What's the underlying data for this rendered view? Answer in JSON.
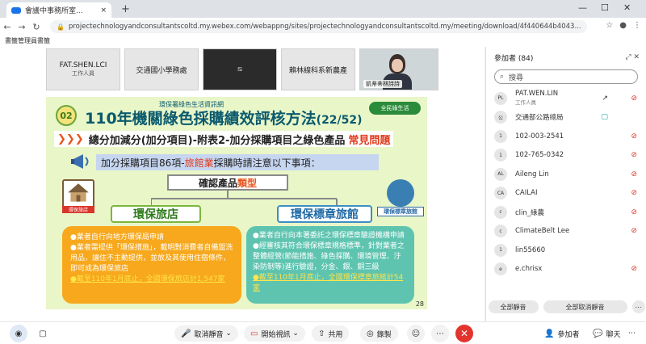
{
  "browser": {
    "tab_title": "會議中事務所室...",
    "tab_close": "×",
    "new_tab": "+",
    "window_controls": [
      "—",
      "☐",
      "✕"
    ],
    "url": "projectechnologyandconsultantscoltd.my.webex.com/webappng/sites/projectechnologyandconsultantscoltd.my/meeting/download/4f440644b4043...",
    "bookmarks_label": "書籤管理員書籤"
  },
  "stage": {
    "thumbnails": [
      {
        "name": "FAT.SHEN.LCI",
        "sub": "工作人員"
      },
      {
        "name": "交通國小學務處",
        "sub": ""
      },
      {
        "name": "⧅",
        "sub": ""
      },
      {
        "name": "賴林線科系新農產",
        "sub": ""
      },
      {
        "name": "",
        "nametag": "凱蒂蒂林詩詩"
      }
    ]
  },
  "slide": {
    "header_small": "環保署綠色生活資訊網",
    "number": "02",
    "title": "110年機關綠色採購績效評核方法",
    "title_page": "(22/52)",
    "logo": "全民綠生活",
    "banner_chev": "❯❯❯",
    "banner_text": "總分加減分(加分項目)-附表2-加分採購項目之綠色產品",
    "banner_hl": "常見問題",
    "sub_pre": "加分採購項目86項-",
    "sub_red": "旅館業",
    "sub_post": "採購時請注意以下事項：",
    "confirm_pre": "確認產品",
    "confirm_hl": "類型",
    "left_icon_label": "環保旅店",
    "right_icon_label": "環保標章旅館",
    "cat_left": "環保旅店",
    "cat_right": "環保標章旅館",
    "left_lines": [
      "●業者自行向地方環保局申請",
      "●業者需提供「環保措施」，載明對消費者自備盥洗用品，讓住不主動提供，並放及其使用住宿條件，即可成為環保旅店",
      "●截至110年1月底止，全國環保旅店計1,547家"
    ],
    "right_lines": [
      "●業者自行向本署委託之環保標章驗證機構申請",
      "●經審核其符合環保標章規格標準，針對業者之整體經營(節能措施、綠色採購、環境管理、汙染防制等)進行驗證，分金、銀、銅三級",
      "●截至110年1月底止，全國環保標章旅館計54家"
    ],
    "page_footer": "28"
  },
  "participants": {
    "header": "參加者 (84)",
    "search_placeholder": "搜尋",
    "list": [
      {
        "initials": "PL",
        "name": "PAT.WEN.LIN",
        "sub": "工作人員"
      },
      {
        "initials": "公",
        "name": "交通部公路總局"
      },
      {
        "initials": "1",
        "name": "102-003-2541"
      },
      {
        "initials": "1",
        "name": "102-765-0342"
      },
      {
        "initials": "AL",
        "name": "Aileng Lin"
      },
      {
        "initials": "CA",
        "name": "CAILAI"
      },
      {
        "initials": "c",
        "name": "clin_綠農"
      },
      {
        "initials": "c",
        "name": "ClimateBelt Lee"
      },
      {
        "initials": "1",
        "name": "lin55660"
      },
      {
        "initials": "e",
        "name": "e.chrisx"
      }
    ],
    "mute_all": "全部靜音",
    "unmute_all": "全部取消靜音"
  },
  "controls": {
    "mute": "取消靜音",
    "stop_video": "開始視訊",
    "share": "共用",
    "record": "錄製",
    "participants": "參加者",
    "chat": "聊天"
  }
}
